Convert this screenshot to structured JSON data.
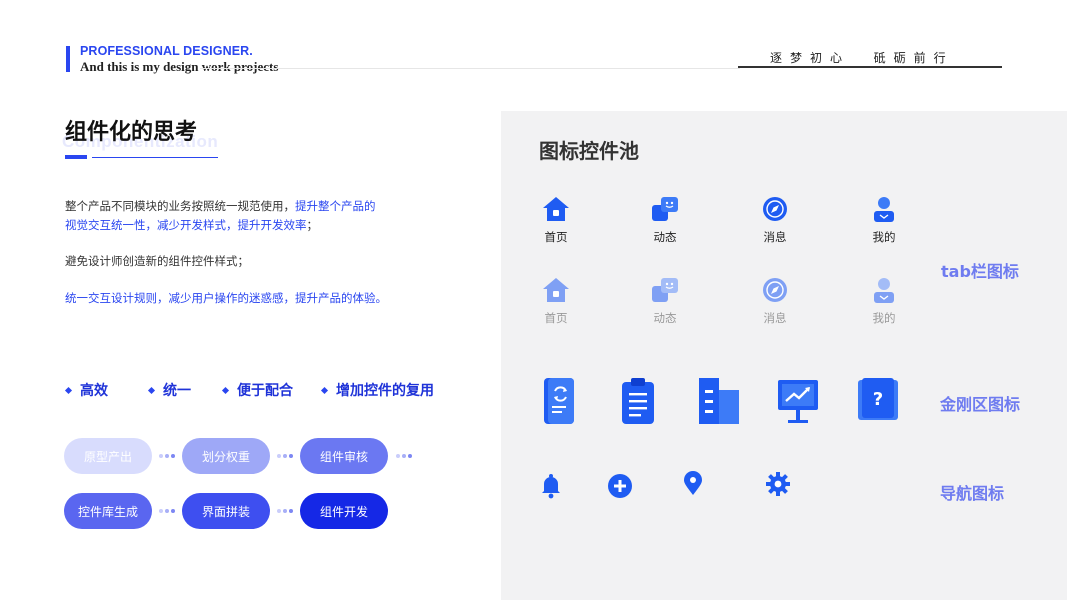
{
  "header": {
    "title": "PROFESSIONAL DESIGNER.",
    "subtitle": "And this is my design work projects",
    "slogan": "逐梦初心  砥砺前行"
  },
  "section": {
    "title": "组件化的思考",
    "bg_text": "Componentization",
    "para1_a": "整个产品不同模块的业务按照统一规范使用，",
    "para1_b": "提升整个产品的",
    "para1_c": "视觉交互统一性，减少开发样式，提升开发效率",
    "para1_d": "；",
    "para2": "避免设计师创造新的组件控件样式；",
    "para3": "统一交互设计规则，减少用户操作的迷惑感，提升产品的体验。"
  },
  "features": [
    "高效",
    "统一",
    "便于配合",
    "增加控件的复用"
  ],
  "flow": [
    "原型产出",
    "划分权重",
    "组件审核",
    "控件库生成",
    "界面拼装",
    "组件开发"
  ],
  "pool": {
    "title": "图标控件池",
    "tab_labels": [
      "首页",
      "动态",
      "消息",
      "我的"
    ],
    "side_labels": {
      "tab": "tab栏图标",
      "kingkong": "金刚区图标",
      "nav": "导航图标"
    }
  },
  "icons": {
    "tab": [
      "home-icon",
      "chat-bubbles-icon",
      "compass-icon",
      "user-icon"
    ],
    "kingkong": [
      "phone-refresh-icon",
      "clipboard-icon",
      "buildings-icon",
      "presentation-chart-icon",
      "book-question-icon"
    ],
    "nav": [
      "bell-icon",
      "plus-circle-icon",
      "location-pin-icon",
      "gear-icon"
    ]
  },
  "colors": {
    "accent": "#2a46f0",
    "panel_bg": "#f2f2f3",
    "side_label": "#6f7cf0"
  }
}
